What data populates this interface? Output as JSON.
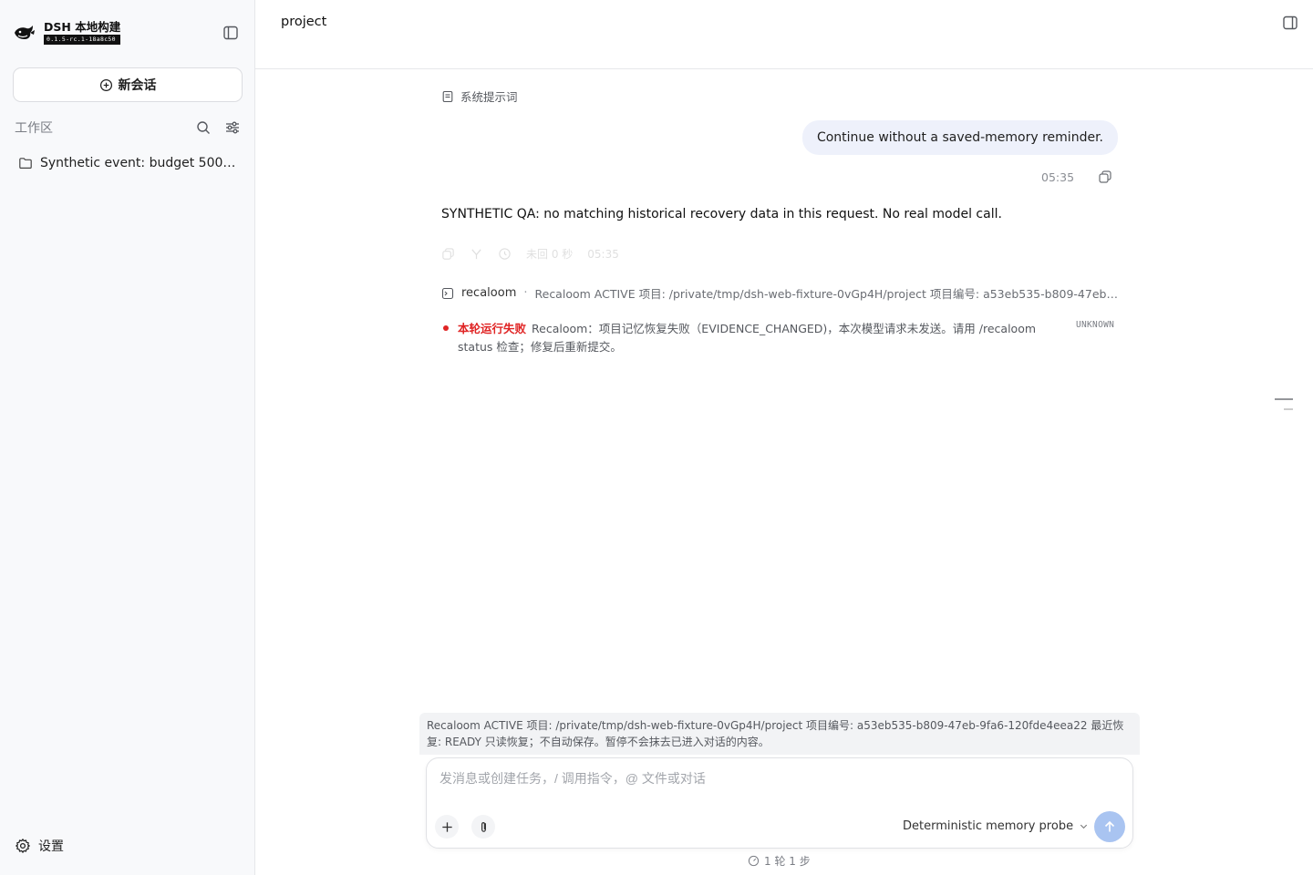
{
  "brand": {
    "title": "DSH 本地构建",
    "version": "0.1.5-rc.1-18a8c50"
  },
  "sidebar": {
    "new_chat_label": "新会话",
    "workspace_label": "工作区",
    "items": [
      {
        "label": "Synthetic event: budget 5000 / ..."
      }
    ],
    "settings_label": "设置"
  },
  "header": {
    "title": "project"
  },
  "conversation": {
    "system_prompt_label": "系统提示词",
    "user_message": "Continue without a saved-memory reminder.",
    "user_time": "05:35",
    "assistant_message": "SYNTHETIC QA: no matching historical recovery data in this request. No real model call.",
    "faded_actions_text": "未回 0 秒",
    "faded_time": "05:35",
    "tool": {
      "name": "recaloom",
      "separator": "·",
      "detail": "Recaloom ACTIVE 项目: /private/tmp/dsh-web-fixture-0vGp4H/project 项目编号: a53eb535-b809-47eb-..."
    },
    "error": {
      "title": "本轮运行失败",
      "message": "Recaloom：项目记忆恢复失败（EVIDENCE_CHANGED)，本次模型请求未发送。请用 /recaloom status 检查；修复后重新提交。",
      "status": "UNKNOWN"
    }
  },
  "status_banner": "Recaloom ACTIVE 项目: /private/tmp/dsh-web-fixture-0vGp4H/project 项目编号: a53eb535-b809-47eb-9fa6-120fde4eea22 最近恢复: READY 只读恢复；不自动保存。暂停不会抹去已进入对话的内容。",
  "composer": {
    "placeholder": "发消息或创建任务，/ 调用指令，@ 文件或对话",
    "model_label": "Deterministic memory probe"
  },
  "step_counter": "1 轮 1 步",
  "colors": {
    "accent": "#a9c4f1",
    "error": "#e02424",
    "user_bubble": "#eef1fb"
  }
}
